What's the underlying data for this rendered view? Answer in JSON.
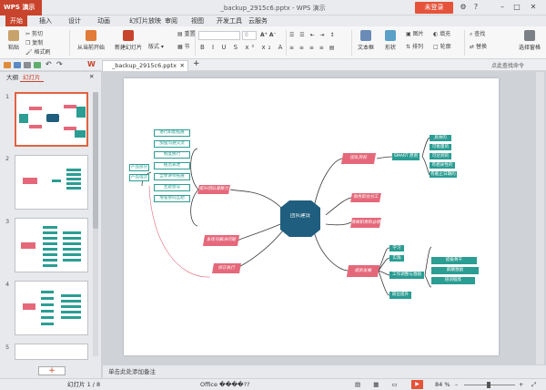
{
  "app": {
    "name": "WPS 演示",
    "doc_title": "_backup_2915c6.pptx - WPS 演示",
    "login": "未登录"
  },
  "menu": [
    "开始",
    "插入",
    "设计",
    "动画",
    "幻灯片放映",
    "审阅",
    "视图",
    "开发工具",
    "云服务"
  ],
  "ribbon": {
    "paste": "粘贴",
    "cut": "剪切",
    "copy": "复制",
    "format_painter": "格式刷",
    "from_current": "从当前开始",
    "new_slide": "新建幻灯片",
    "layout": "版式",
    "reset": "重置",
    "section": "节",
    "font_size": "0",
    "textbox": "文本框",
    "shape": "形状",
    "picture": "图片",
    "arrange": "排列",
    "find": "查找",
    "replace": "替换",
    "select_pane": "选择窗格",
    "fill": "填充",
    "outline": "轮廓"
  },
  "doc_tab": "_backup_2915c6.pptx",
  "doc_tab_extra": "点此查找命令",
  "side": {
    "tab_outline": "大纲",
    "tab_slides": "幻灯片",
    "slide_numbers": [
      "1",
      "2",
      "3",
      "4",
      "5"
    ]
  },
  "notes_placeholder": "单击此处添加备注",
  "status": {
    "slide_index": "幻灯片 1 / 8",
    "theme": "Office ����??",
    "zoom": "84 %"
  },
  "mindmap": {
    "center": "团队建设",
    "left_branches": [
      {
        "label": "提升团队凝聚力",
        "children": [
          "进行职能拓展",
          "加强沟通交流",
          "制度执行",
          "规范表述",
          "全体讲师拓展",
          "主题会议",
          "增强协同互助"
        ]
      },
      {
        "label": "发现与解决问题"
      },
      {
        "label": "修正执行"
      }
    ],
    "left_sub_labels": [
      "产品部分",
      "产品理念"
    ],
    "right_branches": [
      {
        "label": "团队目标",
        "smart": "SMART 原则",
        "children": [
          "具体的",
          "可衡量的",
          "可达到的",
          "有相关性的",
          "有截止日期的"
        ]
      },
      {
        "label": "角色职位分工"
      },
      {
        "label": "清晰职责和业绩"
      },
      {
        "label": "成员发展",
        "children": [
          "学习",
          "实践",
          "工作调整与激励",
          "岗位提升"
        ],
        "leaves": [
          "提拔骨干",
          "薪酬激励",
          "培训锻炼"
        ]
      }
    ]
  },
  "colors": {
    "brand": "#c8442c",
    "teal": "#2b9d93",
    "pink": "#e5687a",
    "center": "#1f5e7e"
  }
}
